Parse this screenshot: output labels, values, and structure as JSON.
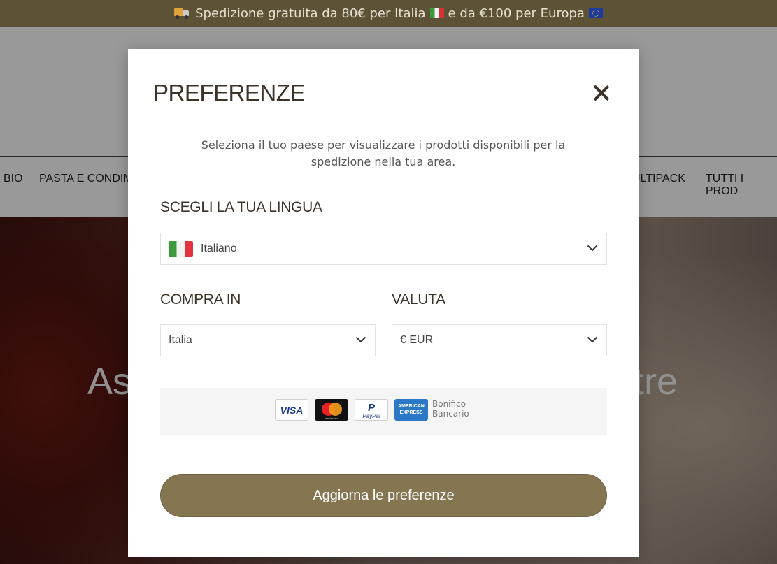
{
  "announcement": {
    "text_1": "Spedizione gratuita da 80€ per Italia",
    "text_2": "e da €100 per Europa"
  },
  "nav": {
    "items": [
      "BIO",
      "PASTA E CONDIM",
      "ULTIPACK",
      "TUTTI I PROD"
    ]
  },
  "hero": {
    "title_left": "As",
    "title_right": "tre"
  },
  "modal": {
    "title": "PREFERENZE",
    "intro": "Seleziona il tuo paese per visualizzare i prodotti disponibili per la spedizione nella tua area.",
    "language_label": "SCEGLI LA TUA LINGUA",
    "language_value": "Italiano",
    "country_label": "COMPRA IN",
    "country_value": "Italia",
    "currency_label": "VALUTA",
    "currency_value": "€ EUR",
    "payments": {
      "visa": "VISA",
      "mastercard": "mastercard",
      "paypal": "PayPal",
      "amex_1": "AMERICAN",
      "amex_2": "EXPRESS",
      "bonifico_1": "Bonifico",
      "bonifico_2": "Bancario"
    },
    "submit_label": "Aggiorna le preferenze"
  },
  "colors": {
    "announcement_bg": "#5e5236",
    "accent": "#857550",
    "title_text": "#3d3429"
  },
  "icons": [
    "delivery-truck-icon",
    "italy-flag-icon",
    "eu-flag-icon",
    "close-icon",
    "chevron-down-icon"
  ]
}
